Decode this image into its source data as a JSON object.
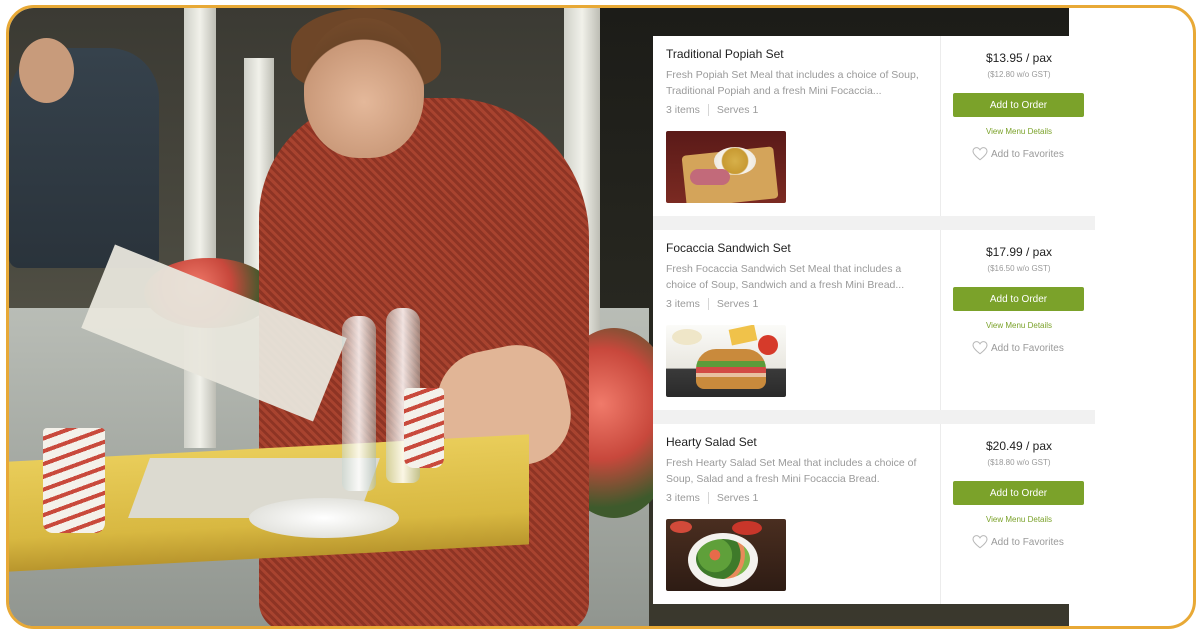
{
  "photo": {
    "description_icon": "vintage-cafe-photo"
  },
  "menu": {
    "items": [
      {
        "name": "Traditional Popiah Set",
        "description": "Fresh Popiah Set Meal that includes a choice of Soup, Traditional Popiah and a fresh Mini Focaccia...",
        "count": "3 items",
        "serves": "Serves 1",
        "price": "$13.95 / pax",
        "price_gst": "($12.80 w/o GST)",
        "order_label": "Add to Order",
        "details_label": "View Menu Details",
        "favorite_label": "Add to Favorites",
        "image_icon": "popiah-food-image"
      },
      {
        "name": "Focaccia Sandwich Set",
        "description": "Fresh Focaccia Sandwich Set Meal that includes a choice of Soup, Sandwich and a fresh Mini Bread...",
        "count": "3 items",
        "serves": "Serves 1",
        "price": "$17.99 / pax",
        "price_gst": "($16.50 w/o GST)",
        "order_label": "Add to Order",
        "details_label": "View Menu Details",
        "favorite_label": "Add to Favorites",
        "image_icon": "sandwich-food-image"
      },
      {
        "name": "Hearty Salad Set",
        "description": "Fresh Hearty Salad Set Meal that includes a choice of Soup, Salad and a fresh Mini Focaccia Bread.",
        "count": "3 items",
        "serves": "Serves 1",
        "price": "$20.49 / pax",
        "price_gst": "($18.80 w/o GST)",
        "order_label": "Add to Order",
        "details_label": "View Menu Details",
        "favorite_label": "Add to Favorites",
        "image_icon": "salad-food-image"
      }
    ]
  },
  "colors": {
    "frame_border": "#e8a936",
    "accent_green": "#7ba22a",
    "muted_text": "#9a9a9a",
    "title_text": "#222222"
  }
}
